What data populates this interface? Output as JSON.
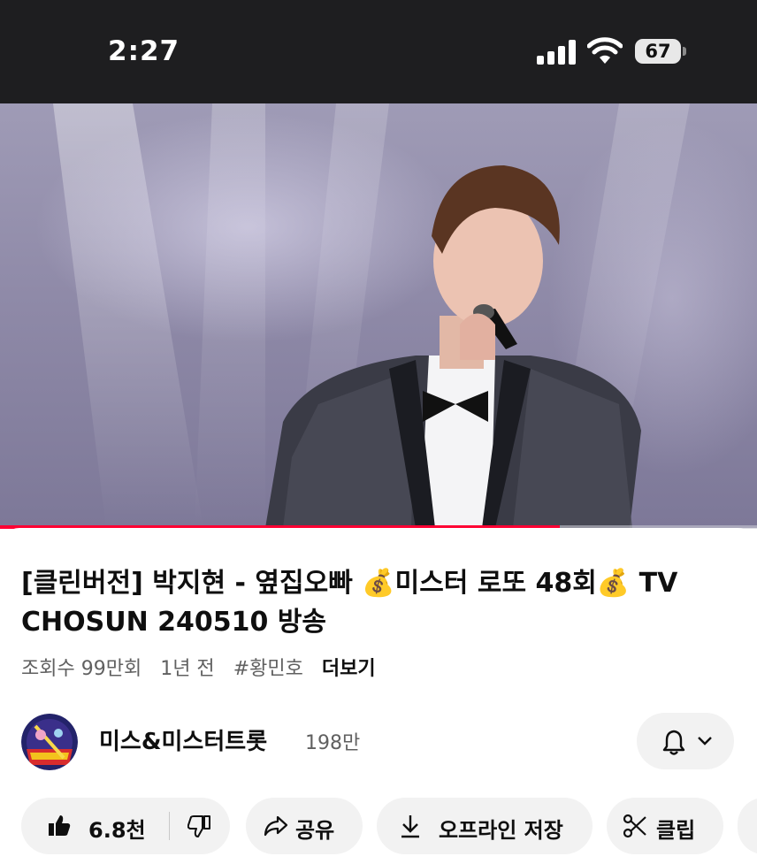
{
  "status_bar": {
    "time": "2:27",
    "battery": "67"
  },
  "video": {
    "progress": 0.74,
    "progress_color": "#ff0033"
  },
  "title": "[클린버전] 박지현 - 옆집오빠 💰미스터 로또 48회💰 TV CHOSUN 240510 방송",
  "meta": {
    "views": "조회수 99만회",
    "age": "1년 전",
    "hashtag": "#황민호",
    "more": "더보기"
  },
  "channel": {
    "name": "미스&미스터트롯",
    "subscribers": "198만",
    "avatar_icon": "channel-avatar"
  },
  "actions": {
    "like_count": "6.8천",
    "share": "공유",
    "download": "오프라인 저장",
    "clip": "클립"
  },
  "icons": [
    "signal-icon",
    "wifi-icon",
    "battery-icon",
    "bell-icon",
    "chevron-down-icon",
    "thumbs-up-icon",
    "thumbs-down-icon",
    "share-icon",
    "download-icon",
    "scissors-icon"
  ]
}
